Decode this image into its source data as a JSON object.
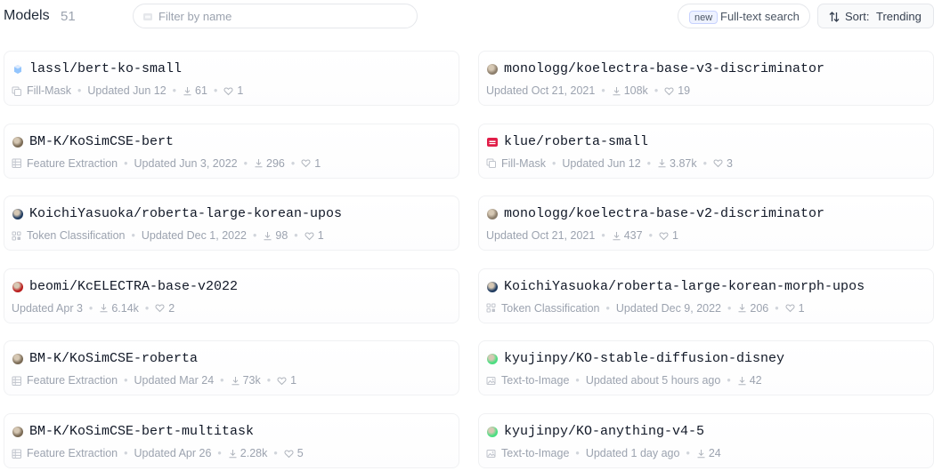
{
  "header": {
    "title": "Models",
    "count": "51",
    "filter_placeholder": "Filter by name",
    "fulltext_badge": "new",
    "fulltext_label": "Full-text search",
    "sort_label": "Sort:",
    "sort_value": "Trending"
  },
  "models": [
    {
      "name": "lassl/bert-ko-small",
      "avatar": "cube-icon",
      "avatar_color": "#93c5fd",
      "task": "Fill-Mask",
      "task_icon": "fill-mask-icon",
      "updated": "Updated Jun 12",
      "downloads": "61",
      "likes": "1"
    },
    {
      "name": "monologg/koelectra-base-v3-discriminator",
      "avatar": "user-avatar",
      "avatar_color": "#8b7d6b",
      "task": "",
      "task_icon": "",
      "updated": "Updated Oct 21, 2021",
      "downloads": "108k",
      "likes": "19"
    },
    {
      "name": "BM-K/KoSimCSE-bert",
      "avatar": "user-avatar",
      "avatar_color": "#7a6a55",
      "task": "Feature Extraction",
      "task_icon": "feature-extraction-icon",
      "updated": "Updated Jun 3, 2022",
      "downloads": "296",
      "likes": "1"
    },
    {
      "name": "klue/roberta-small",
      "avatar": "org-avatar",
      "avatar_color": "#e11d48",
      "task": "Fill-Mask",
      "task_icon": "fill-mask-icon",
      "updated": "Updated Jun 12",
      "downloads": "3.87k",
      "likes": "3"
    },
    {
      "name": "KoichiYasuoka/roberta-large-korean-upos",
      "avatar": "user-avatar",
      "avatar_color": "#1e3a5f",
      "task": "Token Classification",
      "task_icon": "token-classification-icon",
      "updated": "Updated Dec 1, 2022",
      "downloads": "98",
      "likes": "1"
    },
    {
      "name": "monologg/koelectra-base-v2-discriminator",
      "avatar": "user-avatar",
      "avatar_color": "#8b7d6b",
      "task": "",
      "task_icon": "",
      "updated": "Updated Oct 21, 2021",
      "downloads": "437",
      "likes": "1"
    },
    {
      "name": "beomi/KcELECTRA-base-v2022",
      "avatar": "user-avatar",
      "avatar_color": "#b91c1c",
      "task": "",
      "task_icon": "",
      "updated": "Updated Apr 3",
      "downloads": "6.14k",
      "likes": "2"
    },
    {
      "name": "KoichiYasuoka/roberta-large-korean-morph-upos",
      "avatar": "user-avatar",
      "avatar_color": "#1e3a5f",
      "task": "Token Classification",
      "task_icon": "token-classification-icon",
      "updated": "Updated Dec 9, 2022",
      "downloads": "206",
      "likes": "1"
    },
    {
      "name": "BM-K/KoSimCSE-roberta",
      "avatar": "user-avatar",
      "avatar_color": "#7a6a55",
      "task": "Feature Extraction",
      "task_icon": "feature-extraction-icon",
      "updated": "Updated Mar 24",
      "downloads": "73k",
      "likes": "1"
    },
    {
      "name": "kyujinpy/KO-stable-diffusion-disney",
      "avatar": "user-avatar",
      "avatar_color": "#4ade80",
      "task": "Text-to-Image",
      "task_icon": "text-to-image-icon",
      "updated": "Updated about 5 hours ago",
      "downloads": "42",
      "likes": ""
    },
    {
      "name": "BM-K/KoSimCSE-bert-multitask",
      "avatar": "user-avatar",
      "avatar_color": "#7a6a55",
      "task": "Feature Extraction",
      "task_icon": "feature-extraction-icon",
      "updated": "Updated Apr 26",
      "downloads": "2.28k",
      "likes": "5"
    },
    {
      "name": "kyujinpy/KO-anything-v4-5",
      "avatar": "user-avatar",
      "avatar_color": "#4ade80",
      "task": "Text-to-Image",
      "task_icon": "text-to-image-icon",
      "updated": "Updated 1 day ago",
      "downloads": "24",
      "likes": ""
    }
  ]
}
